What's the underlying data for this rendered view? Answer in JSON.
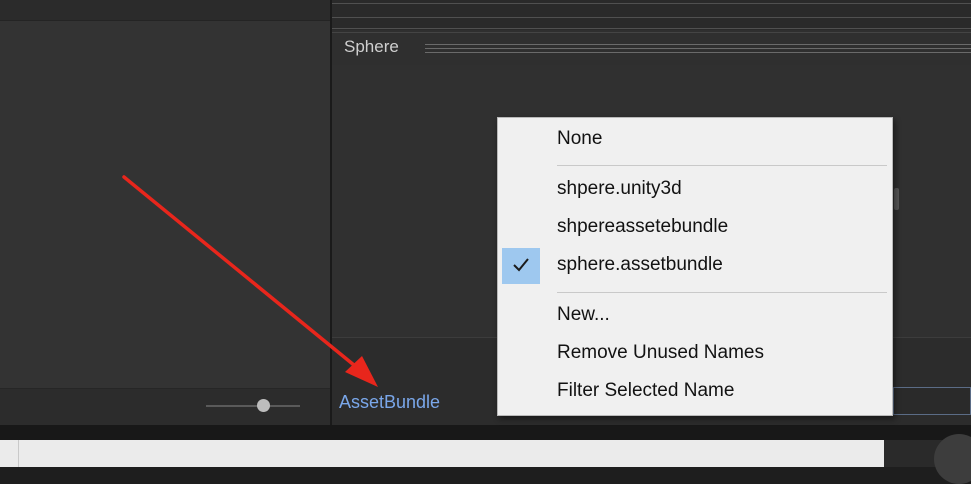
{
  "inspector": {
    "object_title": "Sphere",
    "assetbundle_label": "AssetBundle"
  },
  "dropdown": {
    "items": [
      {
        "label": "None",
        "checked": false
      },
      {
        "label": "shpere.unity3d",
        "checked": false
      },
      {
        "label": "shpereassetebundle",
        "checked": false
      },
      {
        "label": "sphere.assetbundle",
        "checked": true
      },
      {
        "label": "New...",
        "checked": false
      },
      {
        "label": "Remove Unused Names",
        "checked": false
      },
      {
        "label": "Filter Selected Name",
        "checked": false
      }
    ]
  },
  "icons": {
    "check": "checkmark-icon",
    "annotation": "red-arrow-annotation"
  },
  "colors": {
    "panel_bg": "#333333",
    "label_blue": "#7aa7ea",
    "menu_bg": "#f0f0f0",
    "check_highlight": "#9ec8ef",
    "arrow_red": "#e8261c"
  }
}
